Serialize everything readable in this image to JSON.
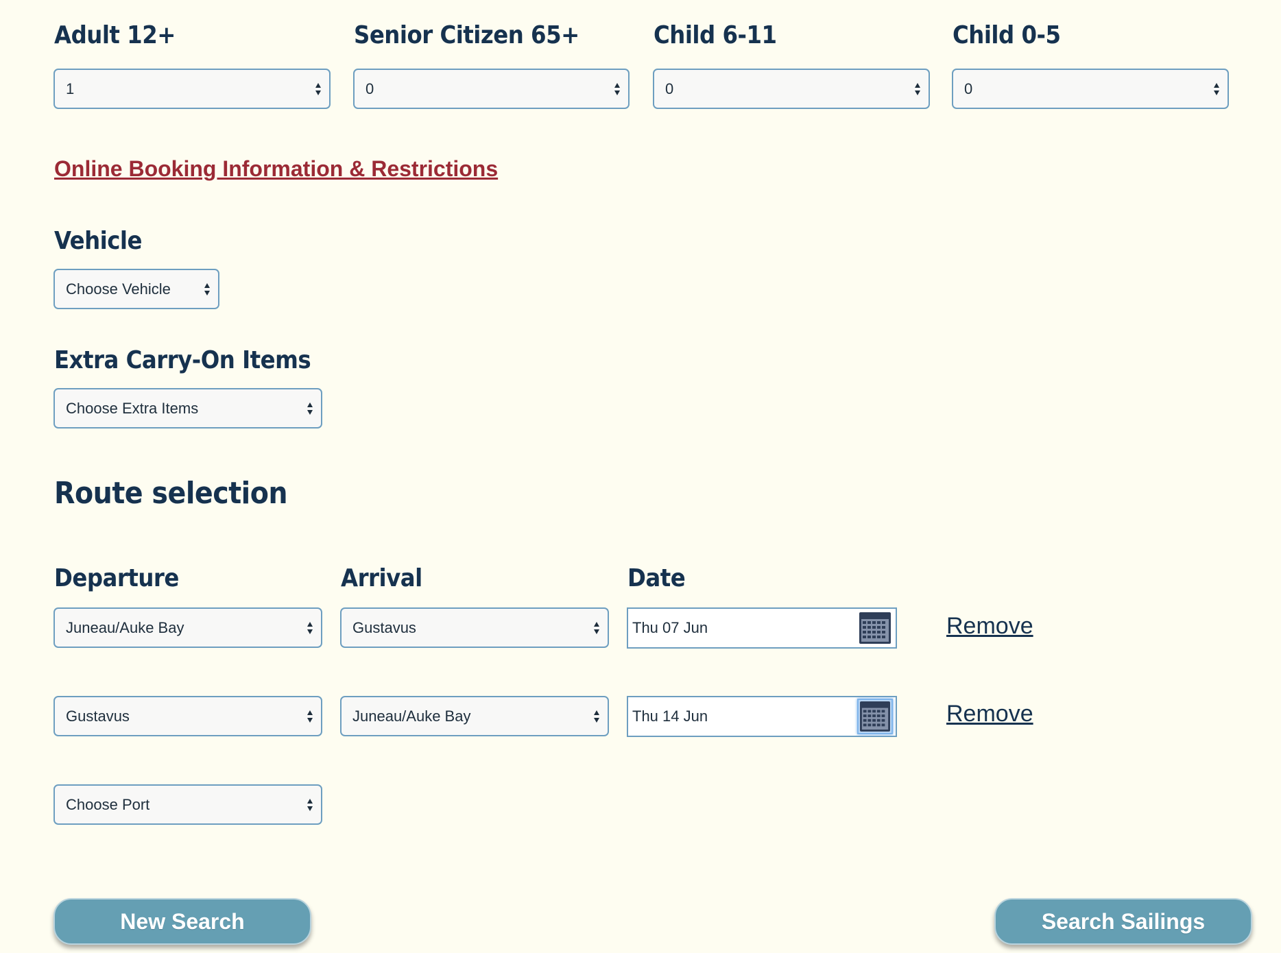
{
  "passengers": {
    "adult": {
      "label": "Adult 12+",
      "value": "1"
    },
    "senior": {
      "label": "Senior Citizen 65+",
      "value": "0"
    },
    "child_6_11": {
      "label": "Child 6-11",
      "value": "0"
    },
    "child_0_5": {
      "label": "Child 0-5",
      "value": "0"
    }
  },
  "info_link": "Online Booking Information & Restrictions",
  "vehicle": {
    "label": "Vehicle",
    "value": "Choose Vehicle"
  },
  "extra_items": {
    "label": "Extra Carry-On Items",
    "value": "Choose Extra Items"
  },
  "route": {
    "title": "Route selection",
    "departure_label": "Departure",
    "arrival_label": "Arrival",
    "date_label": "Date",
    "legs": [
      {
        "departure": "Juneau/Auke Bay",
        "arrival": "Gustavus",
        "date": "Thu 07 Jun",
        "remove": "Remove"
      },
      {
        "departure": "Gustavus",
        "arrival": "Juneau/Auke Bay",
        "date": "Thu 14 Jun",
        "remove": "Remove"
      }
    ],
    "next_port": "Choose Port"
  },
  "buttons": {
    "new_search": "New Search",
    "search_sailings": "Search Sailings"
  },
  "colors": {
    "background": "#fefdf1",
    "heading": "#16324f",
    "link_red": "#9b2a35",
    "button": "#659fb3",
    "field_border": "#6d9ec0"
  }
}
